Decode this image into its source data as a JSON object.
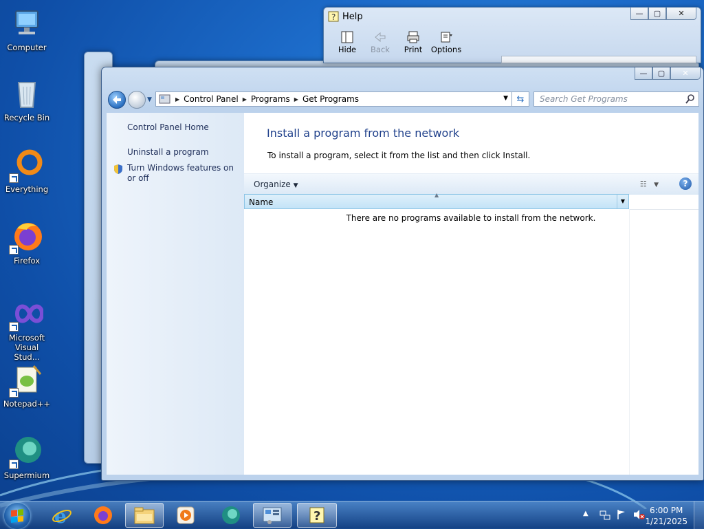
{
  "desktop": {
    "icons": [
      {
        "label": "Computer"
      },
      {
        "label": "Recycle Bin"
      },
      {
        "label": "Everything"
      },
      {
        "label": "Firefox"
      },
      {
        "label": "Microsoft Visual Stud..."
      },
      {
        "label": "Notepad++"
      },
      {
        "label": "Supermium"
      }
    ]
  },
  "help_window": {
    "title": "Help",
    "tools": [
      {
        "label": "Hide",
        "icon": "hide-icon",
        "enabled": true
      },
      {
        "label": "Back",
        "icon": "back-arrow-icon",
        "enabled": false
      },
      {
        "label": "Print",
        "icon": "printer-icon",
        "enabled": true
      },
      {
        "label": "Options",
        "icon": "options-icon",
        "enabled": true
      }
    ]
  },
  "main_window": {
    "breadcrumb": [
      "Control Panel",
      "Programs",
      "Get Programs"
    ],
    "search_placeholder": "Search Get Programs",
    "sidebar": {
      "home": "Control Panel Home",
      "uninstall": "Uninstall a program",
      "features": "Turn Windows features on or off"
    },
    "heading": "Install a program from the network",
    "instruction": "To install a program, select it from the list and then click Install.",
    "organize_label": "Organize",
    "column_name": "Name",
    "empty_message": "There are no programs available to install from the network."
  },
  "taskbar": {
    "time": "6:00 PM",
    "date": "1/21/2025",
    "apps": [
      "internet-explorer",
      "firefox",
      "file-explorer",
      "media-player",
      "supermium",
      "control-panel",
      "help"
    ]
  }
}
